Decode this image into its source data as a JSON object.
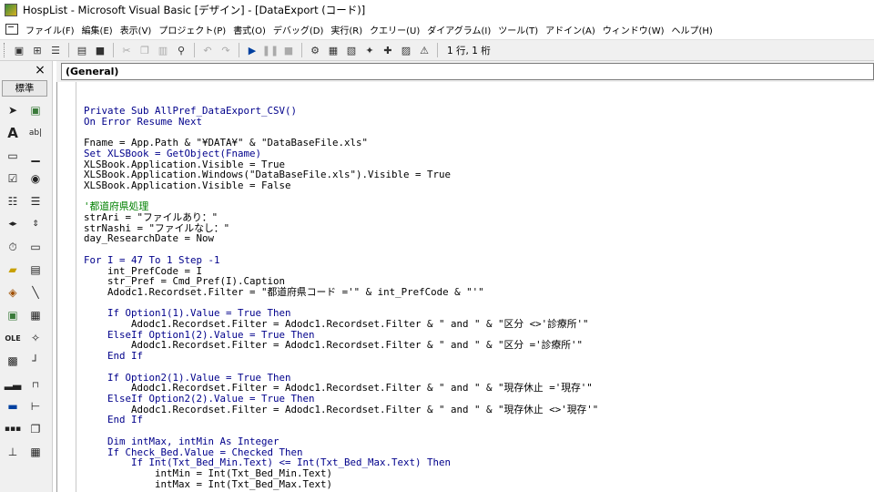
{
  "window": {
    "title": "HospList - Microsoft Visual Basic [デザイン] - [DataExport (コード)]"
  },
  "menu": [
    "ファイル(F)",
    "編集(E)",
    "表示(V)",
    "プロジェクト(P)",
    "書式(O)",
    "デバッグ(D)",
    "実行(R)",
    "クエリー(U)",
    "ダイアグラム(I)",
    "ツール(T)",
    "アドイン(A)",
    "ウィンドウ(W)",
    "ヘルプ(H)"
  ],
  "toolbar": {
    "position": "1 行, 1 桁"
  },
  "toolbox": {
    "tab": "標準",
    "close": "×"
  },
  "combo": {
    "value": "(General)"
  },
  "code": [
    {
      "t": "Private Sub AllPref_DataExport_CSV()",
      "c": "kw"
    },
    {
      "t": "On Error Resume Next",
      "c": "kw"
    },
    {
      "t": "",
      "c": ""
    },
    {
      "t": "Fname = App.Path & \"¥DATA¥\" & \"DataBaseFile.xls\"",
      "c": ""
    },
    {
      "t": "Set XLSBook = GetObject(Fname)",
      "c": "kw"
    },
    {
      "t": "XLSBook.Application.Visible = True",
      "c": ""
    },
    {
      "t": "XLSBook.Application.Windows(\"DataBaseFile.xls\").Visible = True",
      "c": ""
    },
    {
      "t": "XLSBook.Application.Visible = False",
      "c": ""
    },
    {
      "t": "",
      "c": ""
    },
    {
      "t": "'都道府県処理",
      "c": "cm"
    },
    {
      "t": "strAri = \"ファイルあり：\"",
      "c": ""
    },
    {
      "t": "strNashi = \"ファイルなし：\"",
      "c": ""
    },
    {
      "t": "day_ResearchDate = Now",
      "c": ""
    },
    {
      "t": "",
      "c": ""
    },
    {
      "t": "For I = 47 To 1 Step -1",
      "c": "kw"
    },
    {
      "t": "    int_PrefCode = I",
      "c": ""
    },
    {
      "t": "    str_Pref = Cmd_Pref(I).Caption",
      "c": ""
    },
    {
      "t": "    Adodc1.Recordset.Filter = \"都道府県コード ='\" & int_PrefCode & \"'\"",
      "c": ""
    },
    {
      "t": "",
      "c": ""
    },
    {
      "t": "    If Option1(1).Value = True Then",
      "c": "kw"
    },
    {
      "t": "        Adodc1.Recordset.Filter = Adodc1.Recordset.Filter & \" and \" & \"区分 <>'診療所'\"",
      "c": ""
    },
    {
      "t": "    ElseIf Option1(2).Value = True Then",
      "c": "kw"
    },
    {
      "t": "        Adodc1.Recordset.Filter = Adodc1.Recordset.Filter & \" and \" & \"区分 ='診療所'\"",
      "c": ""
    },
    {
      "t": "    End If",
      "c": "kw"
    },
    {
      "t": "",
      "c": ""
    },
    {
      "t": "    If Option2(1).Value = True Then",
      "c": "kw"
    },
    {
      "t": "        Adodc1.Recordset.Filter = Adodc1.Recordset.Filter & \" and \" & \"現存休止 ='現存'\"",
      "c": ""
    },
    {
      "t": "    ElseIf Option2(2).Value = True Then",
      "c": "kw"
    },
    {
      "t": "        Adodc1.Recordset.Filter = Adodc1.Recordset.Filter & \" and \" & \"現存休止 <>'現存'\"",
      "c": ""
    },
    {
      "t": "    End If",
      "c": "kw"
    },
    {
      "t": "",
      "c": ""
    },
    {
      "t": "    Dim intMax, intMin As Integer",
      "c": "kw"
    },
    {
      "t": "    If Check_Bed.Value = Checked Then",
      "c": "kw"
    },
    {
      "t": "        If Int(Txt_Bed_Min.Text) <= Int(Txt_Bed_Max.Text) Then",
      "c": "kw"
    },
    {
      "t": "            intMin = Int(Txt_Bed_Min.Text)",
      "c": ""
    },
    {
      "t": "            intMax = Int(Txt_Bed_Max.Text)",
      "c": ""
    }
  ]
}
